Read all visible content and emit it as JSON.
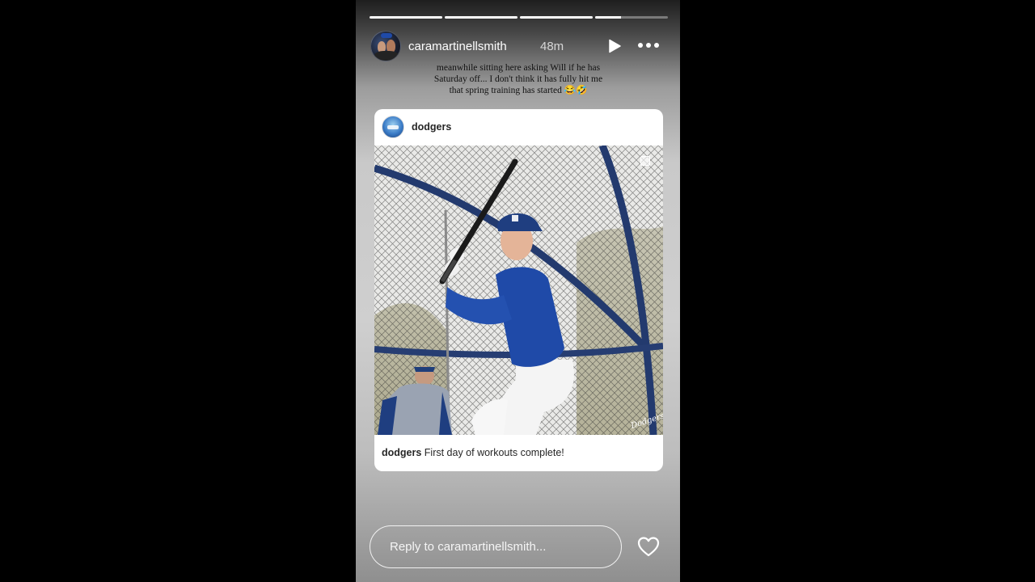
{
  "story": {
    "progress_segments": [
      1,
      1,
      1,
      0.35
    ],
    "username": "caramartinellsmith",
    "time": "48m",
    "caption_lines": [
      "meanwhile sitting here asking Will if he has",
      "Saturday off... I don't think it has fully hit me",
      "that spring training has started 😂🤣"
    ]
  },
  "post": {
    "username": "dodgers",
    "caption_user": "dodgers",
    "caption_text": " First day of workouts complete!",
    "watermark": "Dodgers"
  },
  "reply": {
    "placeholder": "Reply to caramartinellsmith..."
  },
  "icons": {
    "play": "play-icon",
    "more": "more-options-icon",
    "heart": "heart-icon",
    "multi": "carousel-icon"
  }
}
